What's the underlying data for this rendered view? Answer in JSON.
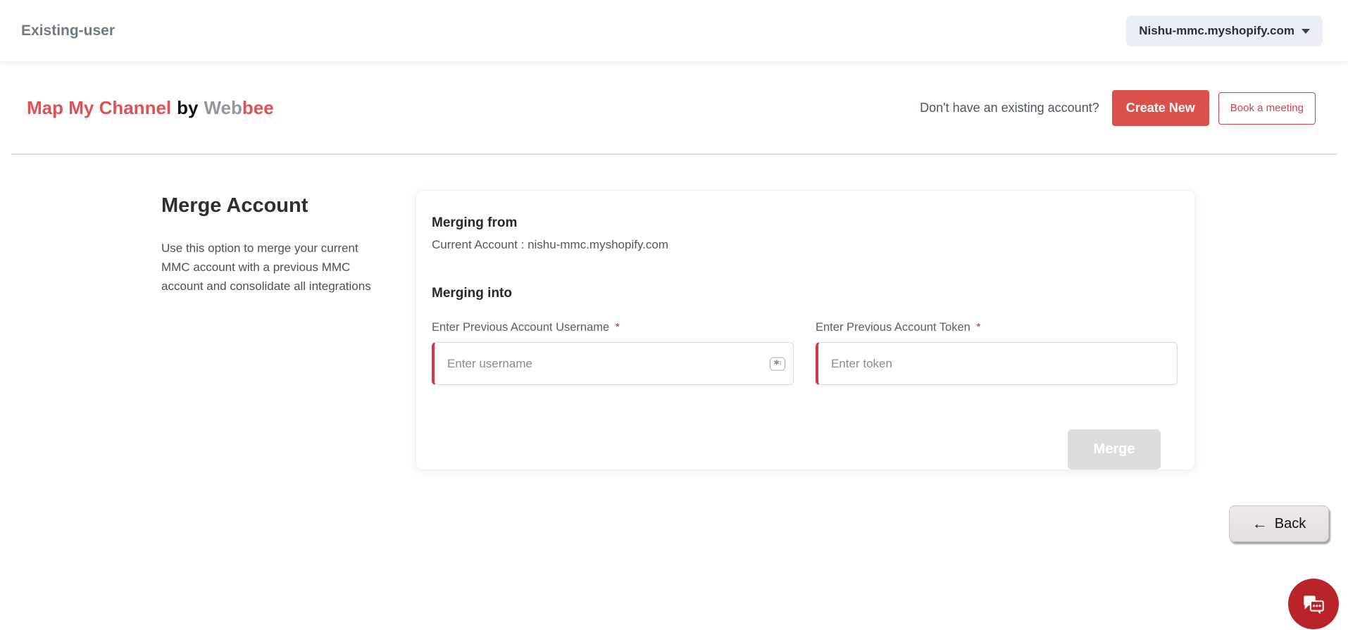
{
  "topbar": {
    "title": "Existing-user",
    "store_selector": {
      "label": "Nishu-mmc.myshopify.com"
    }
  },
  "header": {
    "brand": {
      "name": "Map My Channel",
      "by": "by",
      "vendor_gray": "Web",
      "vendor_red": "bee"
    },
    "prompt": "Don't have an existing account?",
    "create_new_label": "Create New",
    "book_meeting_label": "Book a meeting"
  },
  "main": {
    "section_title": "Merge Account",
    "section_description": "Use this option to merge your current MMC account with a previous MMC account and consolidate all integrations",
    "card": {
      "merging_from_label": "Merging from",
      "current_account": "Current Account : nishu-mmc.myshopify.com",
      "merging_into_label": "Merging into",
      "username_field": {
        "label": "Enter Previous Account Username",
        "required_mark": "*",
        "placeholder": "Enter username",
        "value": ""
      },
      "token_field": {
        "label": "Enter Previous Account Token",
        "required_mark": "*",
        "placeholder": "Enter token",
        "value": ""
      },
      "merge_button_label": "Merge"
    }
  },
  "footer": {
    "back_button_label": "Back"
  },
  "icons": {
    "dropdown_caret": "caret-down",
    "back_arrow": "←",
    "autofill_badge": "✱ı",
    "chat": "chat-bubbles"
  },
  "colors": {
    "brand_red": "#e05151",
    "button_red": "#d9504c",
    "outline_red": "#cf4444",
    "input_required_red": "#dc3546",
    "chat_red": "#b9242b",
    "disabled_gray": "#dcdcdc",
    "dropdown_bg": "#e9edf4",
    "muted_text": "#6e7a85"
  }
}
